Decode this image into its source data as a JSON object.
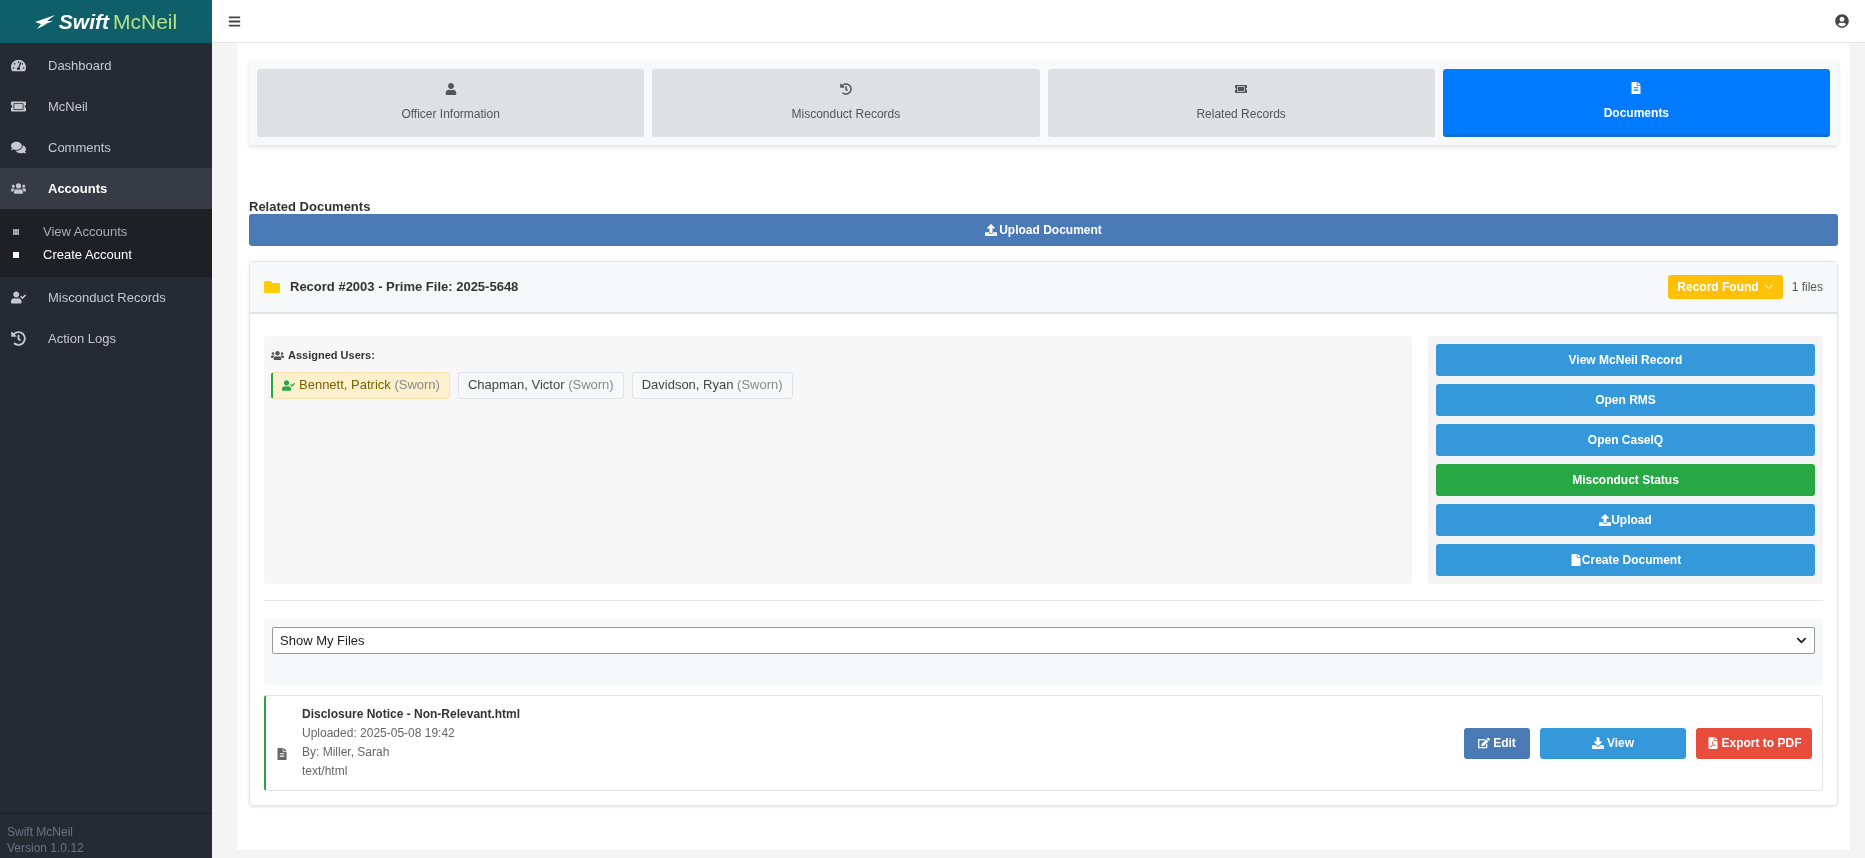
{
  "sidebar": {
    "logo": {
      "word_1": "Swift",
      "word_2": "McNeil"
    },
    "items": [
      {
        "label": "Dashboard",
        "selected": false
      },
      {
        "label": "McNeil",
        "selected": false
      },
      {
        "label": "Comments",
        "selected": false
      },
      {
        "label": "Accounts",
        "selected": true,
        "expanded": true,
        "children": [
          {
            "label": "View Accounts",
            "selected": false
          },
          {
            "label": "Create Account",
            "selected": true
          }
        ]
      },
      {
        "label": "Misconduct Records",
        "selected": false
      },
      {
        "label": "Action Logs",
        "selected": false
      }
    ],
    "footer": {
      "name": "Swift McNeil",
      "version": "Version 1.0.12"
    }
  },
  "tabs": [
    {
      "label": "Officer Information",
      "selected": false
    },
    {
      "label": "Misconduct Records",
      "selected": false
    },
    {
      "label": "Related Records",
      "selected": false
    },
    {
      "label": "Documents",
      "selected": true
    }
  ],
  "section_title": "Related Documents",
  "upload_button": "Upload Document",
  "record": {
    "title": "Record #2003 - Prime File: 2025-5648",
    "status": "Record Found",
    "file_count": "1 files",
    "assigned_label": "Assigned Users:",
    "users": [
      {
        "name": "Bennett, Patrick",
        "role": "(Sworn)",
        "selected": true
      },
      {
        "name": "Chapman, Victor",
        "role": "(Sworn)",
        "selected": false
      },
      {
        "name": "Davidson, Ryan",
        "role": "(Sworn)",
        "selected": false
      }
    ],
    "actions": [
      {
        "label": "View McNeil Record",
        "kind": "primary"
      },
      {
        "label": "Open RMS",
        "kind": "primary"
      },
      {
        "label": "Open CaseIQ",
        "kind": "primary"
      },
      {
        "label": "Misconduct Status",
        "kind": "success"
      },
      {
        "label": "Upload",
        "kind": "upload"
      },
      {
        "label": "Create Document",
        "kind": "create"
      }
    ],
    "filter": {
      "value": "Show My Files"
    },
    "files": [
      {
        "name": "Disclosure Notice - Non-Relevant.html",
        "uploaded": "Uploaded: 2025-05-08 19:42",
        "by": "By: Miller, Sarah",
        "type": "text/html",
        "actions": [
          {
            "label": "Edit",
            "kind": "edit"
          },
          {
            "label": "View",
            "kind": "view"
          },
          {
            "label": "Export to PDF",
            "kind": "pdf"
          }
        ]
      }
    ]
  }
}
